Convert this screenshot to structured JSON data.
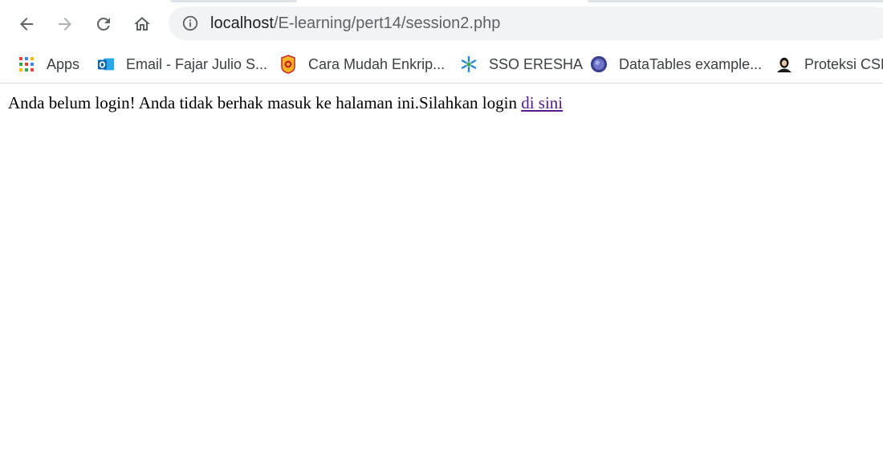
{
  "browser": {
    "url_host": "localhost",
    "url_path": "/E-learning/pert14/session2.php",
    "nav": {
      "back": "back-arrow-icon",
      "forward": "forward-arrow-icon",
      "reload": "reload-icon",
      "home": "home-icon"
    }
  },
  "bookmarks": [
    {
      "label": "Apps",
      "icon": "apps-grid-icon"
    },
    {
      "label": "Email - Fajar Julio S...",
      "icon": "outlook-icon"
    },
    {
      "label": "Cara Mudah Enkrip...",
      "icon": "badge-icon"
    },
    {
      "label": "SSO ERESHA",
      "icon": "sso-icon"
    },
    {
      "label": "DataTables example...",
      "icon": "datatables-icon"
    },
    {
      "label": "Proteksi CSR",
      "icon": "avatar-icon"
    }
  ],
  "page": {
    "message": "Anda belum login! Anda tidak berhak masuk ke halaman ini.Silahkan login ",
    "link_text": "di sini"
  },
  "colors": {
    "link": "#551a8b",
    "omnibox": "#f1f3f4"
  }
}
